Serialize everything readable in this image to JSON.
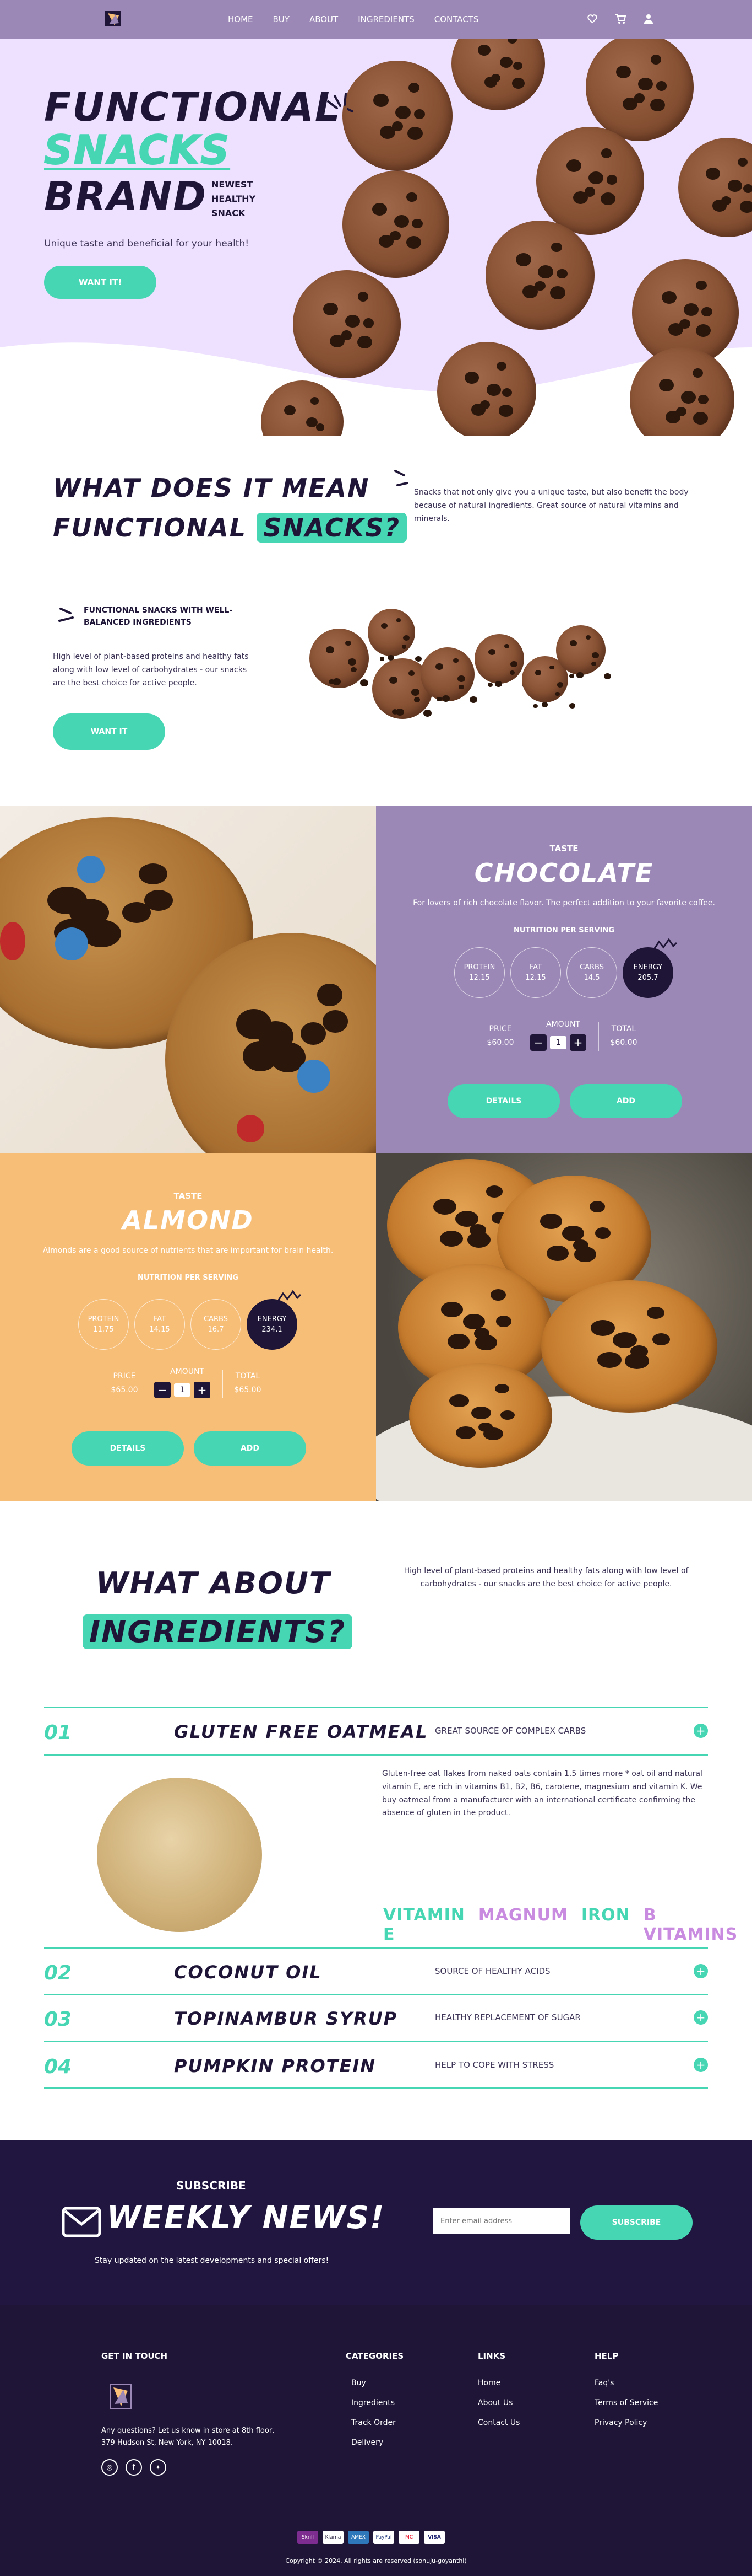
{
  "nav": {
    "menu": [
      "HOME",
      "BUY",
      "ABOUT",
      "INGREDIENTS",
      "CONTACTS"
    ]
  },
  "hero": {
    "line1": "FUNCTIONAL",
    "line2": "SNACKS",
    "line3": "BRAND",
    "tagline": [
      "NEWEST",
      "HEALTHY",
      "SNACK"
    ],
    "subtitle": "Unique taste and beneficial for your health!",
    "cta": "WANT IT!"
  },
  "meaning": {
    "title_line1": "WHAT DOES IT MEAN",
    "title_line2_a": "FUNCTIONAL",
    "title_line2_b": "SNACKS?",
    "right_text": "Snacks that not only give you a unique taste, but also benefit the body because of natural ingredients. Great source of natural vitamins and minerals.",
    "feature_heading": "FUNCTIONAL SNACKS WITH WELL-BALANCED INGREDIENTS",
    "feature_text": "High level of plant-based proteins and healthy fats along with low level of carbohydrates - our snacks are the best choice for active people.",
    "cta": "WANT IT"
  },
  "products": [
    {
      "taste_label": "TASTE",
      "name": "CHOCOLATE",
      "desc": "For lovers of rich chocolate flavor. The perfect addition to your favorite coffee.",
      "nutrition_title": "NUTRITION PER SERVING",
      "nutrients": [
        {
          "label": "PROTEIN",
          "value": "12.15"
        },
        {
          "label": "FAT",
          "value": "12.15"
        },
        {
          "label": "CARBS",
          "value": "14.5"
        },
        {
          "label": "ENERGY",
          "value": "205.7"
        }
      ],
      "price_label": "PRICE",
      "price": "$60.00",
      "amount_label": "AMOUNT",
      "amount": "1",
      "total_label": "TOTAL",
      "total": "$60.00",
      "details": "DETAILS",
      "add": "ADD",
      "color": "#9c88b6"
    },
    {
      "taste_label": "TASTE",
      "name": "ALMOND",
      "desc": "Almonds are a good source of nutrients that are important for brain health.",
      "nutrition_title": "NUTRITION PER SERVING",
      "nutrients": [
        {
          "label": "PROTEIN",
          "value": "11.75"
        },
        {
          "label": "FAT",
          "value": "14.15"
        },
        {
          "label": "CARBS",
          "value": "16.7"
        },
        {
          "label": "ENERGY",
          "value": "234.1"
        }
      ],
      "price_label": "PRICE",
      "price": "$65.00",
      "amount_label": "AMOUNT",
      "amount": "1",
      "total_label": "TOTAL",
      "total": "$65.00",
      "details": "DETAILS",
      "add": "ADD",
      "color": "#f7be78"
    }
  ],
  "ingredients": {
    "title_line1": "WHAT ABOUT",
    "title_line2": "INGREDIENTS?",
    "right_text": "High level of plant-based proteins and healthy fats along with low level of carbohydrates - our snacks are the best choice for active people.",
    "items": [
      {
        "num": "01",
        "name": "GLUTEN FREE OATMEAL",
        "desc": "GREAT SOURCE OF COMPLEX CARBS"
      },
      {
        "num": "02",
        "name": "COCONUT OIL",
        "desc": "SOURCE OF HEALTHY ACIDS"
      },
      {
        "num": "03",
        "name": "TOPINAMBUR SYRUP",
        "desc": "HEALTHY REPLACEMENT OF SUGAR"
      },
      {
        "num": "04",
        "name": "PUMPKIN PROTEIN",
        "desc": "HELP TO COPE WITH STRESS"
      }
    ],
    "detail_text": "Gluten-free oat flakes from naked oats contain 1.5 times more * oat oil and natural vitamin E, are rich in vitamins B1, B2, B6, carotene, magnesium and vitamin K. We buy oatmeal from a manufacturer with an international certificate confirming the absence of gluten in the product.",
    "vitamins": [
      "VITAMIN E",
      "MAGNUM",
      "IRON",
      "B VITAMINS"
    ]
  },
  "subscribe": {
    "label": "SUBSCRIBE",
    "title": "WEEKLY NEWS!",
    "subtitle": "Stay updated on the latest developments and special offers!",
    "placeholder": "Enter email address",
    "button": "SUBSCRIBE"
  },
  "footer": {
    "contact_heading": "GET IN TOUCH",
    "contact_text1": "Any questions? Let us know in store at 8th floor,",
    "contact_text2": "379 Hudson St, New York, NY 10018.",
    "categories_heading": "CATEGORIES",
    "categories": [
      "Buy",
      "Ingredients",
      "Track Order",
      "Delivery"
    ],
    "links_heading": "LINKS",
    "links": [
      "Home",
      "About Us",
      "Contact Us"
    ],
    "help_heading": "HELP",
    "help": [
      "Faq's",
      "Terms of Service",
      "Privacy Policy"
    ],
    "payments": [
      "Skrill",
      "Klarna",
      "AMEX",
      "PayPal",
      "MC",
      "VISA"
    ],
    "copyright": "Copyright © 2024. All rights are reserved (sonuju-goyanthi)"
  },
  "colors": {
    "accent": "#46d6b4",
    "purple": "#9c88b6",
    "dark": "#1e1537",
    "orange": "#f7be78",
    "lavender": "#eee0ff"
  }
}
